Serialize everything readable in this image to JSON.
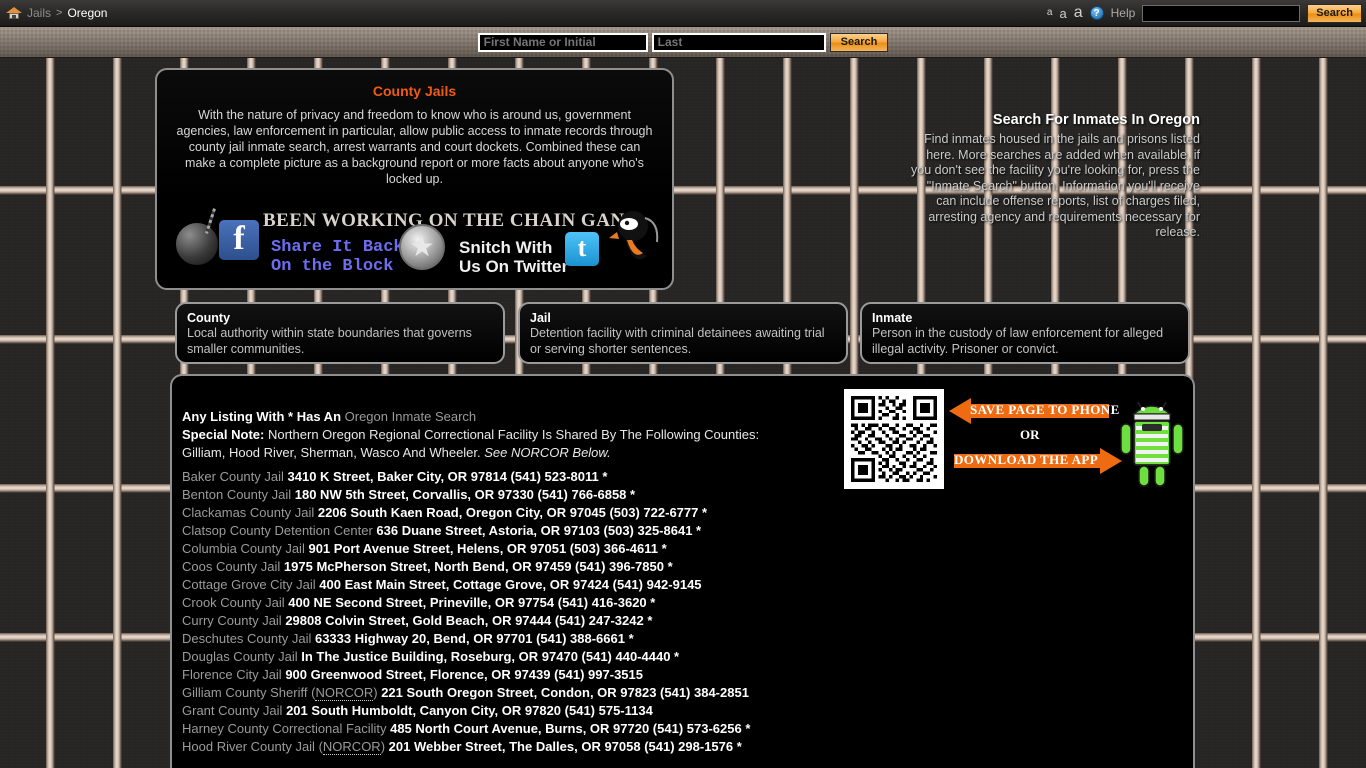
{
  "header": {
    "breadcrumb": {
      "home_icon": "home-icon",
      "root": "Jails",
      "separator": ">",
      "current": "Oregon"
    },
    "font_small": "a",
    "font_medium": "a",
    "font_large": "a",
    "help_icon_glyph": "?",
    "help_label": "Help",
    "search_value": "",
    "search_button": "Search"
  },
  "name_search": {
    "first_placeholder": "First Name or Initial",
    "last_placeholder": "Last",
    "first_value": "",
    "last_value": "",
    "button": "Search"
  },
  "intro": {
    "title": "County Jails",
    "body": "With the nature of privacy and freedom to know who is around us, government agencies, law enforcement in particular, allow public access to inmate records through county jail inmate search, arrest warrants and court dockets. Combined these can make a complete picture as a background report or more facts about anyone who's locked up.",
    "banner": {
      "headline": "BEEN WORKING ON THE CHAIN GANG",
      "facebook_glyph": "f",
      "facebook_text_line1": "Share It Back",
      "facebook_text_line2": "On the Block",
      "star_glyph": "★",
      "twitter_text_line1": "Snitch With",
      "twitter_text_line2": "Us On Twitter",
      "twitter_glyph": "t"
    }
  },
  "right_intro": {
    "title": "Search For Inmates In Oregon",
    "body": "Find inmates housed in the jails and prisons listed here. More searches are added when available, if you don't see the facility you're looking for, press the \"Inmate Search\" button. Information you'll receive can include offense reports, list of charges filed, arresting agency and requirements necessary for release."
  },
  "definitions": [
    {
      "term": "County",
      "desc": "Local authority within state boundaries that governs smaller communities."
    },
    {
      "term": "Jail",
      "desc": "Detention facility with criminal detainees awaiting trial or serving shorter sentences."
    },
    {
      "term": "Inmate",
      "desc": "Person in the custody of law enforcement for alleged illegal activity. Prisoner or convict."
    }
  ],
  "listing": {
    "star_note_bold": "Any Listing With * Has An",
    "star_note_link": "Oregon Inmate Search",
    "special_note_label": "Special Note:",
    "special_note_text": "Northern Oregon Regional Correctional Facility Is Shared By The Following Counties:",
    "shared_counties": "Gilliam, Hood River, Sherman, Wasco And Wheeler.",
    "see_below": "See NORCOR Below.",
    "rows": [
      {
        "name": "Baker County Jail",
        "info": "3410 K Street, Baker City, OR 97814 (541) 523-8011 *"
      },
      {
        "name": "Benton County Jail",
        "info": "180 NW 5th Street, Corvallis, OR 97330 (541) 766-6858 *"
      },
      {
        "name": "Clackamas County Jail",
        "info": "2206 South Kaen Road, Oregon City, OR 97045 (503) 722-6777 *"
      },
      {
        "name": "Clatsop County Detention Center",
        "info": "636 Duane Street, Astoria, OR 97103 (503) 325-8641 *"
      },
      {
        "name": "Columbia County Jail",
        "info": "901 Port Avenue Street, Helens, OR 97051 (503) 366-4611 *"
      },
      {
        "name": "Coos County Jail",
        "info": "1975 McPherson Street, North Bend, OR 97459 (541) 396-7850 *"
      },
      {
        "name": "Cottage Grove City Jail",
        "info": "400 East Main Street, Cottage Grove, OR 97424 (541) 942-9145"
      },
      {
        "name": "Crook County Jail",
        "info": "400 NE Second Street, Prineville, OR 97754 (541) 416-3620 *"
      },
      {
        "name": "Curry County Jail",
        "info": "29808 Colvin Street, Gold Beach, OR 97444 (541) 247-3242 *"
      },
      {
        "name": "Deschutes County Jail",
        "info": "63333 Highway 20, Bend, OR 97701 (541) 388-6661 *"
      },
      {
        "name": "Douglas County Jail",
        "info": "In The Justice Building, Roseburg, OR 97470 (541) 440-4440 *"
      },
      {
        "name": "Florence City Jail",
        "info": "900 Greenwood Street, Florence, OR 97439 (541) 997-3515"
      },
      {
        "name": "Gilliam County Sheriff",
        "abbr": "NORCOR",
        "info": "221 South Oregon Street, Condon, OR 97823 (541) 384-2851"
      },
      {
        "name": "Grant County Jail",
        "info": "201 South Humboldt, Canyon City, OR 97820 (541) 575-1134"
      },
      {
        "name": "Harney County Correctional Facility",
        "info": "485 North Court Avenue, Burns, OR 97720 (541) 573-6256 *"
      },
      {
        "name": "Hood River County Jail",
        "abbr": "NORCOR",
        "info": "201 Webber Street, The Dalles, OR 97058 (541) 298-1576 *"
      }
    ]
  },
  "promo": {
    "qr_alt": "qr-code",
    "save_label": "SAVE PAGE TO PHONE",
    "or_label": "OR",
    "download_label": "DOWNLOAD THE APP",
    "robot_alt": "android-robot-icon"
  },
  "colors": {
    "accent_orange": "#ef5b15",
    "button_orange": "#f7a838",
    "bar_tan": "#cbb6a6",
    "panel_border": "#8f8f8f",
    "text_gray": "#9b9b9b",
    "facebook_blue": "#4a72bb",
    "twitter_blue": "#4fc3f7",
    "android_green": "#6ddf3f"
  }
}
